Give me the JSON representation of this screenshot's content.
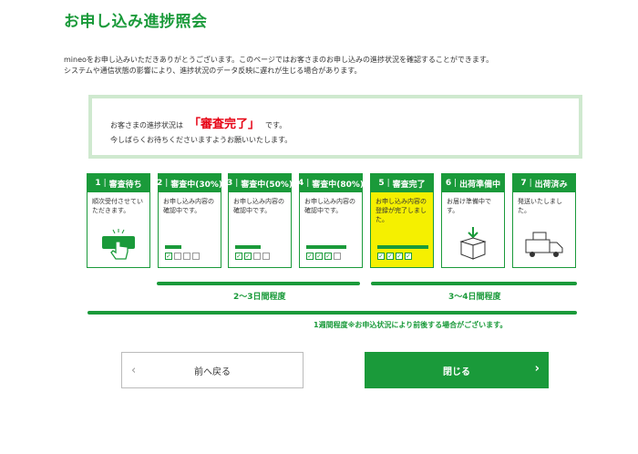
{
  "page": {
    "title": "お申し込み進捗照会",
    "intro_line1": "mineoをお申し込みいただきありがとうございます。このページではお客さまのお申し込みの進捗状況を確認することができます。",
    "intro_line2": "システムや通信状態の影響により、進捗状況のデータ反映に遅れが生じる場合があります。"
  },
  "status": {
    "prefix": "お客さまの進捗状況は",
    "value": "「審査完了」",
    "suffix": "です。",
    "line2": "今しばらくお待ちくださいますようお願いいたします。"
  },
  "steps": [
    {
      "num": "1",
      "label": "審査待ち",
      "text": "順次受付させていただきます。"
    },
    {
      "num": "2",
      "label": "審査中(30%)",
      "text": "お申し込み内容の確認中です。"
    },
    {
      "num": "3",
      "label": "審査中(50%)",
      "text": "お申し込み内容の確認中です。"
    },
    {
      "num": "4",
      "label": "審査中(80%)",
      "text": "お申し込み内容の確認中です。"
    },
    {
      "num": "5",
      "label": "審査完了",
      "text": "お申し込み内容の登録が完了しました。"
    },
    {
      "num": "6",
      "label": "出荷準備中",
      "text": "お届け準備中です。"
    },
    {
      "num": "7",
      "label": "出荷済み",
      "text": "発送いたしました。"
    }
  ],
  "progress": [
    0,
    1,
    2,
    3,
    4
  ],
  "timelines": {
    "a": "2〜3日間程度",
    "b": "3〜4日間程度",
    "c": "1週間程度※お申込状況により前後する場合がございます。"
  },
  "buttons": {
    "back": "前へ戻る",
    "close": "閉じる"
  },
  "colors": {
    "brand_green": "#1a9a3a",
    "highlight": "#f5f000",
    "status_red": "#e60012"
  },
  "icons": [
    "chevron-left-icon",
    "chevron-right-icon",
    "hand-tap-icon",
    "box-arrow-icon",
    "truck-icon"
  ]
}
